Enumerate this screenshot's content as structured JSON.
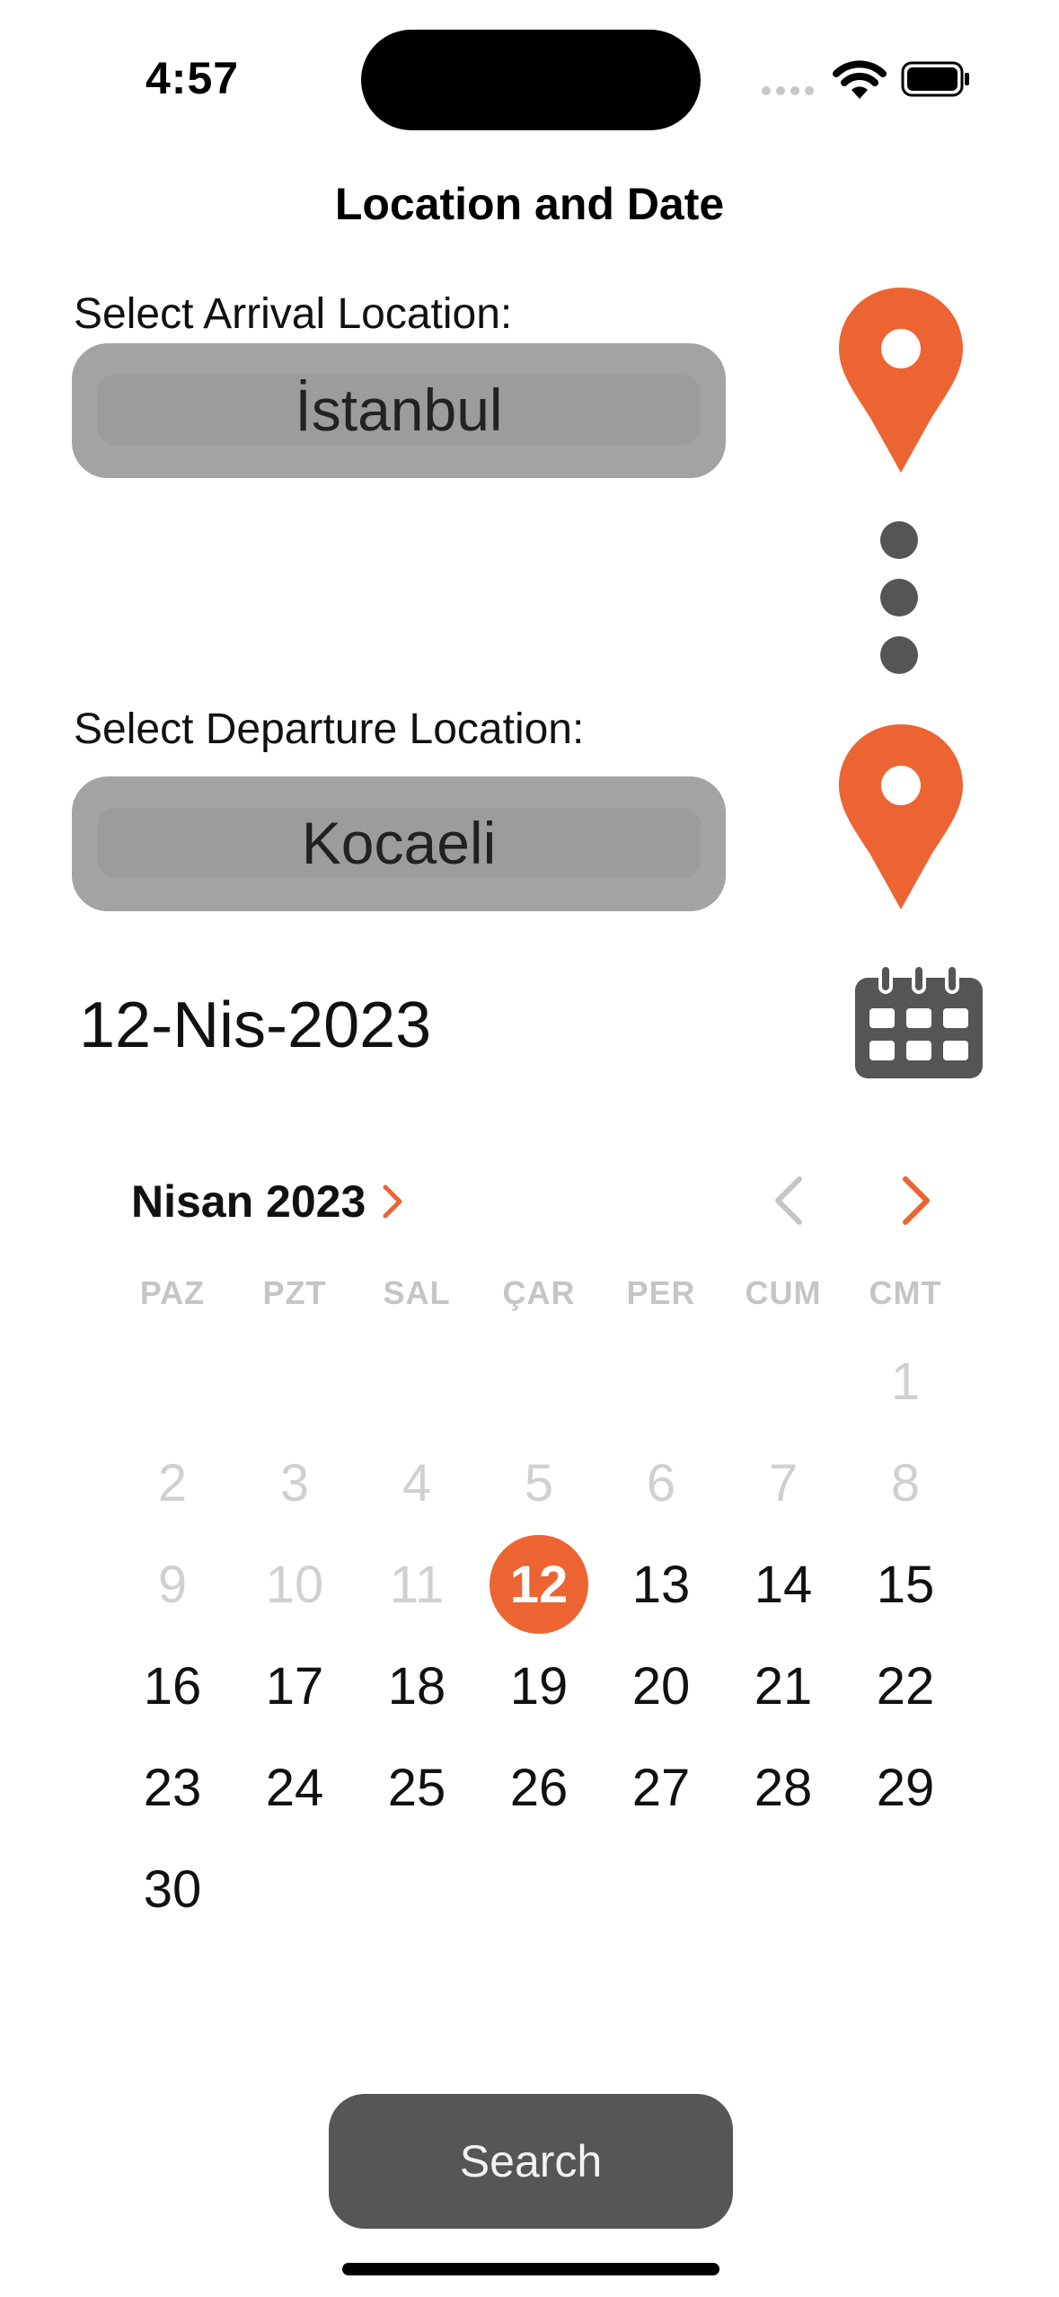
{
  "status_bar": {
    "time": "4:57"
  },
  "header": {
    "title": "Location and Date"
  },
  "arrival": {
    "label": "Select Arrival Location:",
    "value": "İstanbul"
  },
  "departure": {
    "label": "Select Departure Location:",
    "value": "Kocaeli"
  },
  "date": {
    "value": "12-Nis-2023"
  },
  "calendar": {
    "month_label": "Nisan 2023",
    "weekdays": [
      "PAZ",
      "PZT",
      "SAL",
      "ÇAR",
      "PER",
      "CUM",
      "CMT"
    ],
    "first_weekday_index": 6,
    "days_in_month": 30,
    "selected_day": 12,
    "accent_color": "#ed6433"
  },
  "actions": {
    "search_label": "Search"
  },
  "icons": [
    "location-pin-icon",
    "dots-icon",
    "calendar-icon",
    "chevron-right-icon",
    "chevron-left-icon"
  ],
  "colors": {
    "accent": "#ed6433",
    "field_bg": "#a3a3a3",
    "button_bg": "#565656",
    "icon_dark": "#555555"
  }
}
